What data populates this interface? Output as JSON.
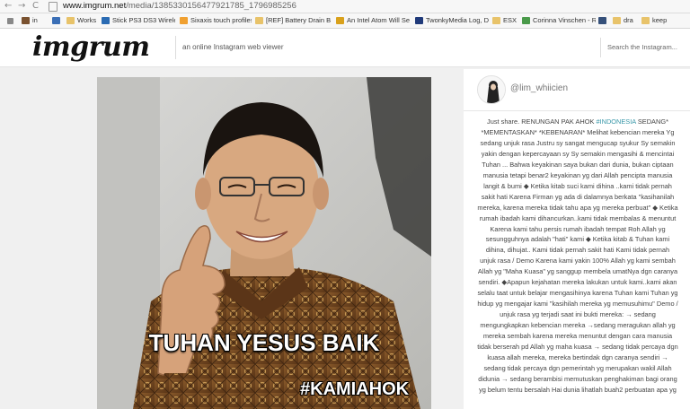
{
  "browser": {
    "url_host": "www.imgrum.net",
    "url_path": "/media/1385330156477921785_1796985256",
    "nav_back": "←",
    "nav_forward": "→",
    "nav_reload": "C",
    "bookmarks": [
      "in",
      "",
      "Works",
      "Stick PS3 DS3 Wirele:",
      "Sixaxis touch profiles",
      "[REF] Battery Drain Bu",
      "An Intel Atom Will Se",
      "TwonkyMedia Log, Di",
      "ESX",
      "Corinna Vinschen - R",
      "",
      "dra",
      "keep"
    ]
  },
  "site": {
    "logo": "imgrum",
    "tagline": "an online Instagram web viewer",
    "search_placeholder": "Search the Instagram..."
  },
  "post": {
    "caption_main": "TUHAN YESUS BAIK",
    "caption_tag": "#KAMIAHOK",
    "username": "@lim_whiicien",
    "description": "Just share. RENUNGAN PAK AHOK #INDONESIA  SEDANG*\n*MEMENTASKAN* *KEBENARAN* Melihat kebencian mereka Yg\nsedang unjuk rasa Justru sy sangat mengucap syukur Sy semakin\nyakin dengan kepercayaan sy Sy semakin mengasihi & mencintai\nTuhan ... Bahwa keyakinan saya bukan dari dunia, bukan ciptaan\nmanusia tetapi benar2 keyakinan yg dari Allah pencipta manusia\nlangit & bumi ◆ Ketika kitab suci kami dihina ..kami tidak pernah\nsakit hati Karena Firman yg ada di dalamnya berkata \"kasihanilah\nmereka, karena mereka tidak tahu apa yg mereka perbuat\" ◆ Ketika\nrumah ibadah kami dihancurkan..kami tidak membalas & menuntut\nKarena kami tahu persis rumah ibadah tempat Roh Allah yg\nsesungguhnya adalah \"hati\" kami ◆ Ketika kitab & Tuhan kami\ndihina, dihujat.. Kami tidak pernah sakit hati Kami tidak pernah\nunjuk rasa / Demo Karena kami yakin 100% Allah yg kami sembah\nAllah yg \"Maha Kuasa\" yg sanggup membela umatNya dgn caranya\nsendiri. ◆Apapun kejahatan mereka lakukan untuk kami..kami akan\nselalu taat untuk belajar mengasihinya karena Tuhan kami Tuhan yg\nhidup yg mengajar kami \"kasihilah mereka yg memusuhimu\" Demo /\nunjuk rasa yg terjadi saat ini bukti mereka: → sedang\nmengungkapkan kebencian mereka →sedang meragukan allah yg\nmereka sembah karena mereka menuntut dengan cara manusia\ntidak berserah pd Allah yg maha kuasa → sedang tidak percaya dgn\nkuasa allah mereka, mereka bertindak dgn caranya sendiri →\nsedang tidak percaya dgn pemerintah yg merupakan wakil Allah\ndidunia → sedang berambisi memutuskan penghakiman bagi orang\nyg belum tentu bersalah Hai dunia lihatlah buah2 perbuatan apa yg"
  },
  "colors": {
    "accent_hashtag": "#3897a8",
    "photo_bg": "#c9c9c7"
  }
}
